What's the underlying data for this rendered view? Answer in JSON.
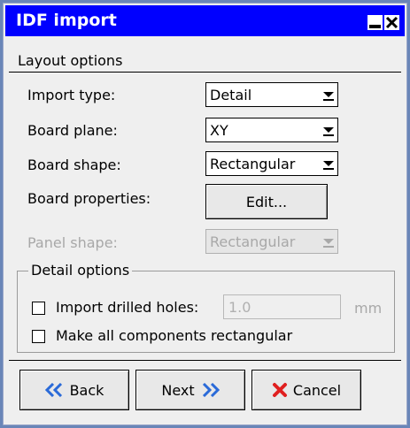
{
  "window": {
    "title": "IDF import"
  },
  "section": {
    "label": "Layout options"
  },
  "fields": {
    "import_type": {
      "label": "Import type:",
      "value": "Detail"
    },
    "board_plane": {
      "label": "Board plane:",
      "value": "XY"
    },
    "board_shape": {
      "label": "Board shape:",
      "value": "Rectangular"
    },
    "board_properties": {
      "label": "Board properties:",
      "button": "Edit..."
    },
    "panel_shape": {
      "label": "Panel shape:",
      "value": "Rectangular"
    }
  },
  "detail_options": {
    "title": "Detail options",
    "import_drilled_holes": {
      "label": "Import drilled holes:",
      "checked": false,
      "value": "1.0",
      "unit": "mm"
    },
    "make_rectangular": {
      "label": "Make all components rectangular",
      "checked": false
    }
  },
  "buttons": {
    "back": "Back",
    "next": "Next",
    "cancel": "Cancel"
  },
  "colors": {
    "titlebar": "#0000ff",
    "frame": "#6a86b8",
    "arrow_blue": "#2a6ad8",
    "cancel_red": "#e02020"
  }
}
